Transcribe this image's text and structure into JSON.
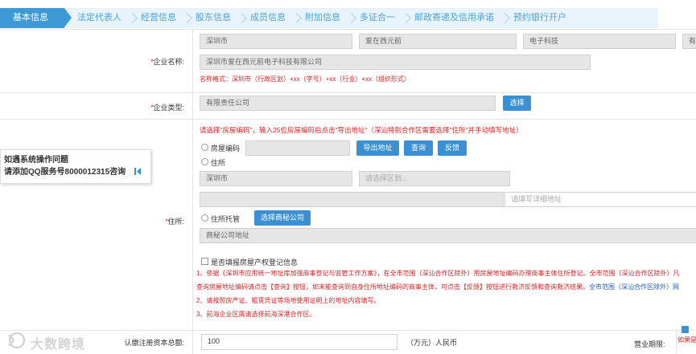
{
  "tabs": [
    "基本信息",
    "法定代表人",
    "经营信息",
    "股东信息",
    "成员信息",
    "附加信息",
    "多证合一",
    "邮政寄递及信用承诺",
    "预约银行开户"
  ],
  "company_name": {
    "label": "企业名称:",
    "city": "深圳市",
    "brand": "爱在西元前",
    "industry": "电子科技",
    "org_form_partial": "有",
    "full_name": "深圳市爱在西元前电子科技有限公司",
    "format_hint": "名称格式：深圳市（行政区划）+xx（字号）+xx（行业）+xx（组织形式）"
  },
  "company_type": {
    "label": "企业类型:",
    "value": "有限责任公司",
    "select_button": "选择"
  },
  "address": {
    "label": "住所:",
    "top_note": "请选择\"房屋编码\"，输入25位房屋编码后点击\"导出地址\"（深汕特别合作区需要选择\"住所\"并手动填写地址）",
    "option_house_code": "房屋编码",
    "btn_export": "导出地址",
    "btn_query": "查询",
    "btn_feedback": "反馈",
    "option_residence": "住所",
    "city": "深圳市",
    "district_placeholder": "请选择区划...",
    "detail_placeholder": "请填写详细地址",
    "option_trust": "住所托管",
    "btn_select_secretary": "选择商秘公司",
    "secretary_address": "商秘公司地址",
    "property_checkbox": "是否填报房屋产权登记信息",
    "notice1": "1、依据《深圳市应用统一地址库加强商事登记与监管工作方案》，在全市范围（深汕合作区除外）用房屋地址编码办理商事主体住所登记。全市范围（深汕合作区除外）凡",
    "notice1b_red": "查询房屋地址编码请点击【查询】按钮，如未能查询到自身住所地址编码的商事主体，可点击【反馈】按钮进行救济反馈和查询救济结果。",
    "notice1b_blue": "全市范围（深汕合作区除外）网",
    "notice2": "2、请按照房产证、租赁凭证等场地使用证明上的地址内容填写。",
    "notice3": "3、前海企业区属请选择前海深港合作区。"
  },
  "capital": {
    "label": "认缴注册资本总额:",
    "value": "100",
    "unit": "（万元）人民币",
    "term_label": "营业期限:",
    "term_partial": "如果是"
  },
  "help": {
    "line1": "如遇系统操作问题",
    "line2": "请添加QQ服务号8000012315咨询"
  },
  "watermark": "大数跨境",
  "colors": {
    "tab_active": "#3d9ad6",
    "tab_bar": "#e8f3fb",
    "button": "#3b8fd3",
    "required": "#e02020"
  }
}
